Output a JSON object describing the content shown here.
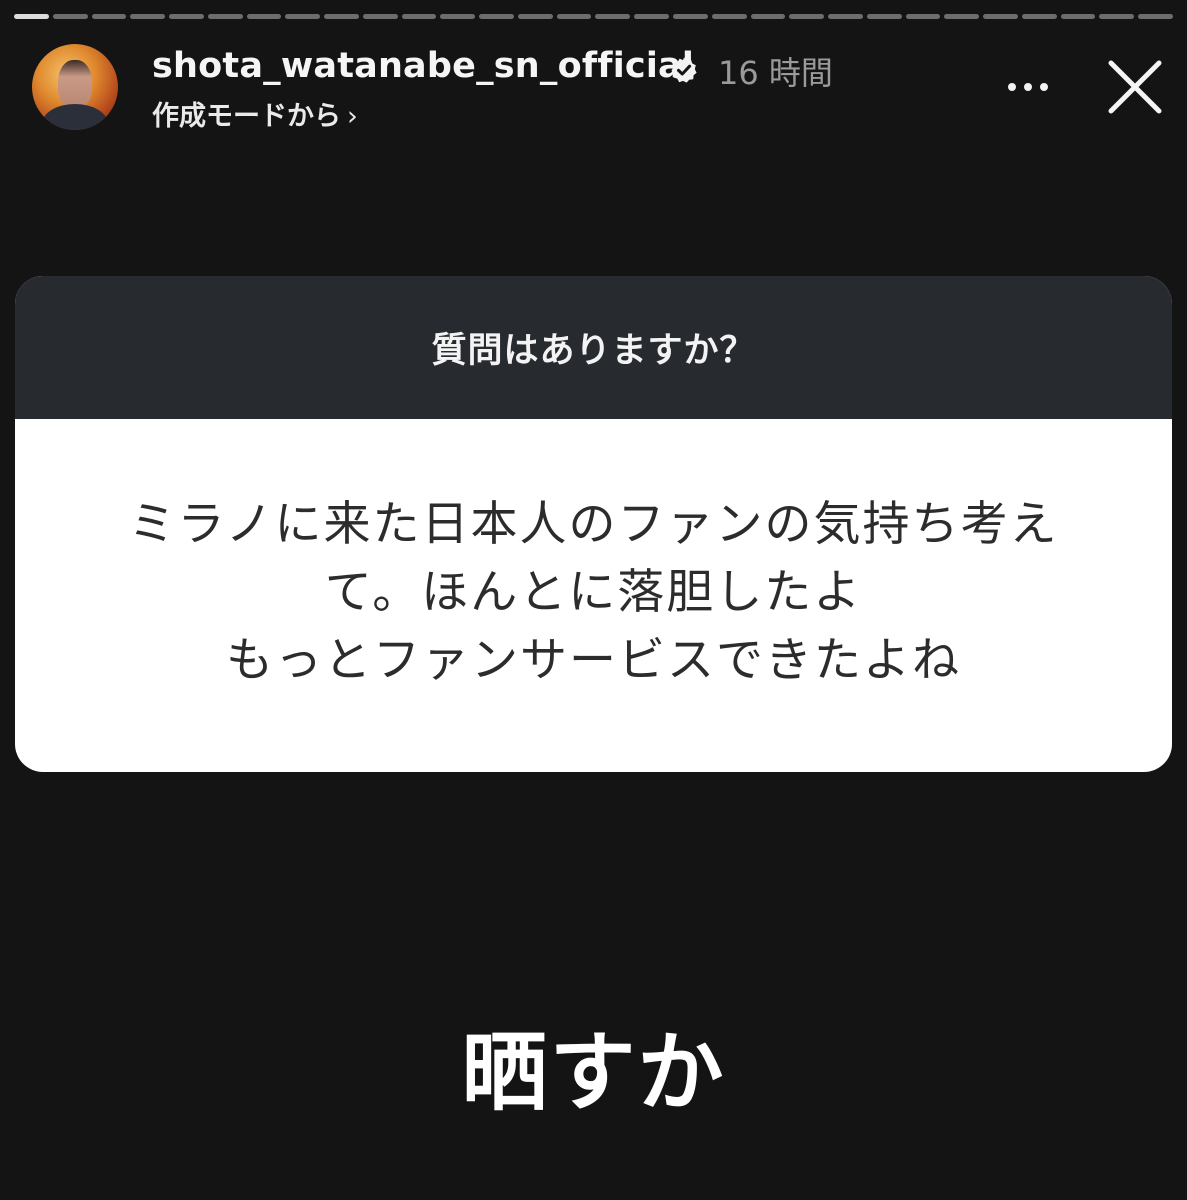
{
  "story": {
    "progress_segments": 30,
    "active_segment": 0
  },
  "header": {
    "username": "shota_watanabe_sn_official",
    "verified_icon": "verified-badge-icon",
    "time": "16 時間",
    "subline": "作成モードから",
    "subline_chevron": "›",
    "more_icon": "more-horizontal-icon",
    "close_icon": "close-icon"
  },
  "question_card": {
    "prompt": "質問はありますか？",
    "answer_lines": [
      "ミラノに来た日本人のファンの気持ち考え",
      "て。ほんとに落胆したよ",
      "もっとファンサービスできたよね"
    ]
  },
  "reply_text": "晒すか",
  "colors": {
    "background": "#141414",
    "card_header": "#272a2f",
    "card_body": "#ffffff",
    "answer_text": "#2c2c2c",
    "time_text": "#9a9a9a"
  }
}
